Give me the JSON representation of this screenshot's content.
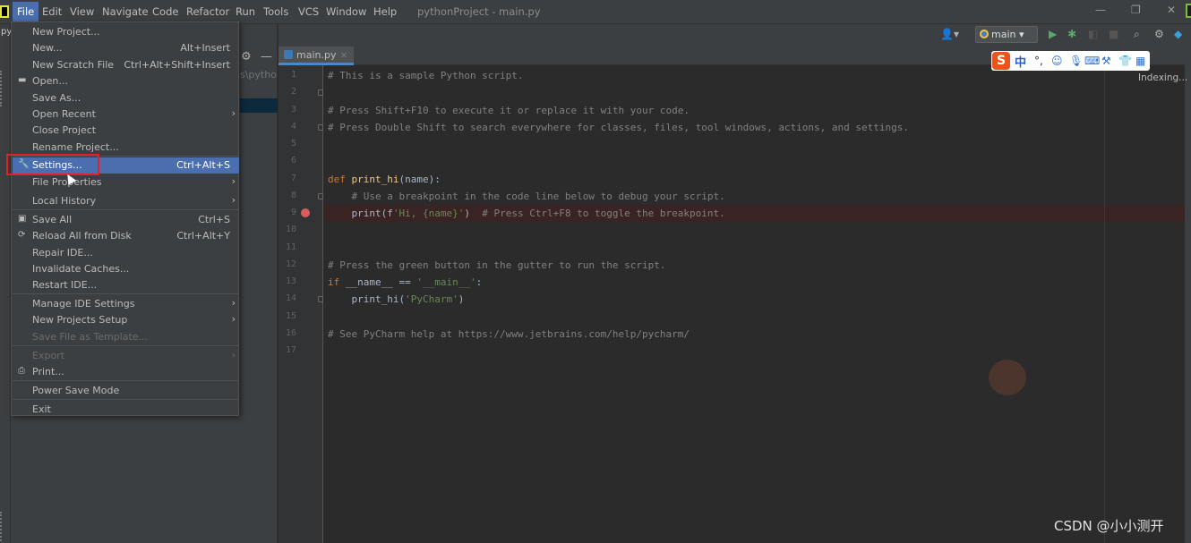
{
  "menu_bar": {
    "items": [
      "File",
      "Edit",
      "View",
      "Navigate",
      "Code",
      "Refactor",
      "Run",
      "Tools",
      "VCS",
      "Window",
      "Help"
    ],
    "window_title": "pythonProject - main.py",
    "active_menu": "File"
  },
  "left_stripe": {
    "label": "py"
  },
  "project_panel": {
    "path_fragment": "s\\pytho"
  },
  "toolbar": {
    "branch": "main"
  },
  "editor": {
    "tab_label": "main.py",
    "tab_close": "×",
    "status": "Indexing...",
    "lines": [
      {
        "no": "1",
        "text": "# This is a sample Python script."
      },
      {
        "no": "2",
        "text": ""
      },
      {
        "no": "3",
        "text": "# Press Shift+F10 to execute it or replace it with your code."
      },
      {
        "no": "4",
        "text": "# Press Double Shift to search everywhere for classes, files, tool windows, actions, and settings."
      },
      {
        "no": "5",
        "text": ""
      },
      {
        "no": "6",
        "text": ""
      },
      {
        "no": "7",
        "text": "def print_hi(name):"
      },
      {
        "no": "8",
        "text": "    # Use a breakpoint in the code line below to debug your script."
      },
      {
        "no": "9",
        "text": "    print(f'Hi, {name}')  # Press Ctrl+F8 to toggle the breakpoint."
      },
      {
        "no": "10",
        "text": ""
      },
      {
        "no": "11",
        "text": ""
      },
      {
        "no": "12",
        "text": "# Press the green button in the gutter to run the script."
      },
      {
        "no": "13",
        "text": "if __name__ == '__main__':"
      },
      {
        "no": "14",
        "text": "    print_hi('PyCharm')"
      },
      {
        "no": "15",
        "text": ""
      },
      {
        "no": "16",
        "text": "# See PyCharm help at https://www.jetbrains.com/help/pycharm/"
      },
      {
        "no": "17",
        "text": ""
      }
    ]
  },
  "file_menu": [
    {
      "label": "New Project...",
      "shortcut": ""
    },
    {
      "label": "New...",
      "shortcut": "Alt+Insert"
    },
    {
      "label": "New Scratch File",
      "shortcut": "Ctrl+Alt+Shift+Insert"
    },
    {
      "label": "Open...",
      "shortcut": ""
    },
    {
      "label": "Save As...",
      "shortcut": ""
    },
    {
      "label": "Open Recent",
      "shortcut": ""
    },
    {
      "label": "Close Project",
      "shortcut": ""
    },
    {
      "label": "Rename Project...",
      "shortcut": ""
    },
    {
      "label": "Settings...",
      "shortcut": "Ctrl+Alt+S"
    },
    {
      "label": "File Properties",
      "shortcut": ""
    },
    {
      "label": "Local History",
      "shortcut": ""
    },
    {
      "label": "Save All",
      "shortcut": "Ctrl+S"
    },
    {
      "label": "Reload All from Disk",
      "shortcut": "Ctrl+Alt+Y"
    },
    {
      "label": "Repair IDE...",
      "shortcut": ""
    },
    {
      "label": "Invalidate Caches...",
      "shortcut": ""
    },
    {
      "label": "Restart IDE...",
      "shortcut": ""
    },
    {
      "label": "Manage IDE Settings",
      "shortcut": ""
    },
    {
      "label": "New Projects Setup",
      "shortcut": ""
    },
    {
      "label": "Save File as Template...",
      "shortcut": ""
    },
    {
      "label": "Export",
      "shortcut": ""
    },
    {
      "label": "Print...",
      "shortcut": ""
    },
    {
      "label": "Power Save Mode",
      "shortcut": ""
    },
    {
      "label": "Exit",
      "shortcut": ""
    }
  ],
  "ime_bar": {
    "logo": "S",
    "mode": "中"
  },
  "watermark": "CSDN @小小测开",
  "colors": {
    "accent": "#4b6eaf",
    "highlight_box": "#e0202a",
    "breakpoint": "#db5c5c"
  }
}
